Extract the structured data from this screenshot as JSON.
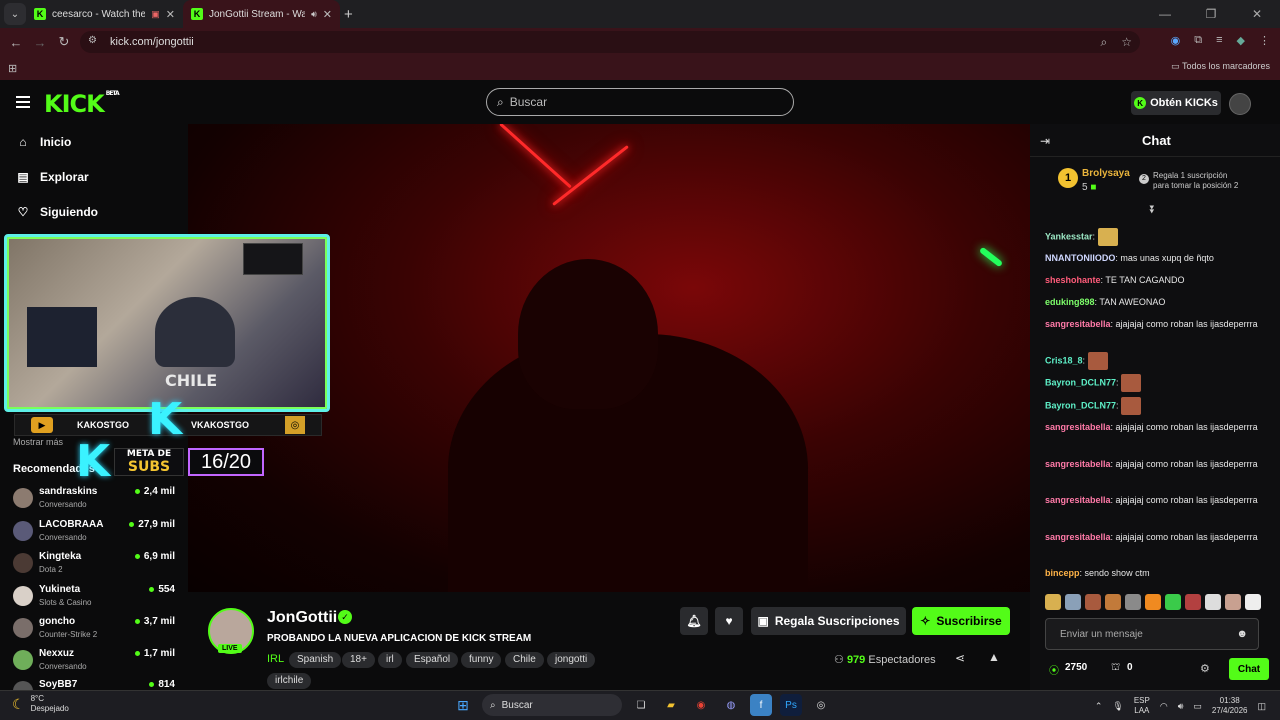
{
  "browser": {
    "tabs": [
      {
        "title": "ceesarco - Watch the VOD",
        "active": false
      },
      {
        "title": "JonGottii Stream - Watch L",
        "active": true
      }
    ],
    "url": "kick.com/jongottii",
    "bookmarks_label": "Todos los marcadores"
  },
  "header": {
    "logo": "KICK",
    "logo_badge": "BETA",
    "search_placeholder": "Buscar",
    "kicks_button": "Obtén KICKs"
  },
  "sidebar": {
    "nav": [
      {
        "label": "Inicio",
        "icon": "home-icon"
      },
      {
        "label": "Explorar",
        "icon": "explore-icon"
      },
      {
        "label": "Siguiendo",
        "icon": "heart-icon"
      }
    ],
    "show_more": "Mostrar más",
    "recommended_title": "Recomendados",
    "recommended": [
      {
        "name": "sandraskins",
        "category": "Conversando",
        "viewers": "2,4 mil"
      },
      {
        "name": "LACOBRAAA",
        "category": "Conversando",
        "viewers": "27,9 mil"
      },
      {
        "name": "Kingteka",
        "category": "Dota 2",
        "viewers": "6,9 mil"
      },
      {
        "name": "Yukineta",
        "category": "Slots & Casino",
        "viewers": "554"
      },
      {
        "name": "goncho",
        "category": "Counter-Strike 2",
        "viewers": "3,7 mil"
      },
      {
        "name": "Nexxuz",
        "category": "Conversando",
        "viewers": "1,7 mil"
      },
      {
        "name": "SoyBB7",
        "category": "",
        "viewers": "814"
      }
    ]
  },
  "overlay": {
    "cam_text": "CHILE",
    "handle_left": "KAKOSTGO",
    "handle_right": "VKAKOSTGO",
    "subs_goal_line1": "META DE",
    "subs_goal_line2": "SUBS",
    "subs_goal_count": "16/20"
  },
  "stream": {
    "channel": "JonGottii",
    "live_badge": "LIVE",
    "title": "PROBANDO LA NUEVA APLICACION DE KICK STREAM",
    "category": "IRL",
    "tags": [
      "Spanish",
      "18+",
      "irl",
      "Español",
      "funny",
      "Chile",
      "jongotti",
      "irlchile"
    ],
    "gift_button": "Regala Suscripciones",
    "subscribe_button": "Suscribirse",
    "viewers_count": "979",
    "viewers_label": "Espectadores"
  },
  "chat": {
    "title": "Chat",
    "leader_rank": "1",
    "leader_name": "Brolysaya",
    "leader_count": "5",
    "leader_second_rank": "2",
    "leader_gift_line1": "Regala 1 suscripción",
    "leader_gift_line2": "para tomar la posición 2",
    "messages": [
      {
        "user": "Yankesstar",
        "text": "",
        "color": "#9be7c4",
        "emote": true
      },
      {
        "user": "NNANTONIIODO",
        "text": "mas unas xupq de ñqto",
        "color": "#cfd7ff"
      },
      {
        "user": "sheshohante",
        "text": "TE TAN CAGANDO",
        "color": "#ff5c7a"
      },
      {
        "user": "eduking898",
        "text": "TAN AWEONAO",
        "color": "#7dff6a"
      },
      {
        "user": "sangresitabella",
        "text": "ajajajaj como roban las ijasdeperrra",
        "color": "#ff7aa8"
      },
      {
        "user": "Cris18_8",
        "text": "",
        "color": "#5ef0c8",
        "emote": true
      },
      {
        "user": "Bayron_DCLN77",
        "text": "",
        "color": "#5ef0c8",
        "emote": true
      },
      {
        "user": "Bayron_DCLN77",
        "text": "",
        "color": "#5ef0c8",
        "emote": true
      },
      {
        "user": "sangresitabella",
        "text": "ajajajaj como roban las ijasdeperrra",
        "color": "#ff7aa8"
      },
      {
        "user": "sangresitabella",
        "text": "ajajajaj como roban las ijasdeperrra",
        "color": "#ff7aa8"
      },
      {
        "user": "sangresitabella",
        "text": "ajajajaj como roban las ijasdeperrra",
        "color": "#ff7aa8"
      },
      {
        "user": "sangresitabella",
        "text": "ajajajaj como roban las ijasdeperrra",
        "color": "#ff7aa8"
      },
      {
        "user": "bincepp",
        "text": "sendo show ctm",
        "color": "#ffb347"
      }
    ],
    "input_placeholder": "Enviar un mensaje",
    "kicks_balance": "2750",
    "points": "0",
    "send_button": "Chat"
  },
  "taskbar": {
    "temp": "8°C",
    "weather": "Despejado",
    "search": "Buscar",
    "lang1": "ESP",
    "lang2": "LAA",
    "time": "01:38",
    "date": "27/4/2026"
  },
  "colors": {
    "brand": "#53fc18",
    "browser_frame": "#39131a"
  }
}
